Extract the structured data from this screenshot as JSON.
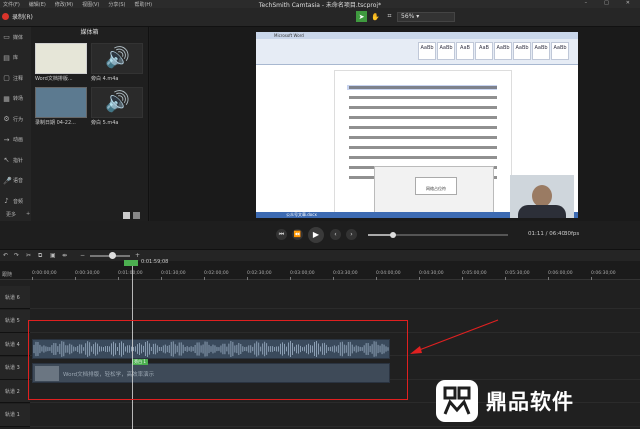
{
  "menu": [
    "文件(F)",
    "编辑(E)",
    "修改(M)",
    "视图(V)",
    "分享(S)",
    "帮助(H)"
  ],
  "window_title": "TechSmith Camtasia - 未命名项目.tscproj*",
  "record_label": "录制(R)",
  "zoom_value": "56%",
  "sidebar": [
    {
      "label": "媒体",
      "icon": "media-icon"
    },
    {
      "label": "库",
      "icon": "library-icon"
    },
    {
      "label": "注释",
      "icon": "annotation-icon"
    },
    {
      "label": "转场",
      "icon": "transition-icon"
    },
    {
      "label": "行为",
      "icon": "behavior-icon"
    },
    {
      "label": "动画",
      "icon": "animation-icon"
    },
    {
      "label": "指针",
      "icon": "cursor-icon"
    },
    {
      "label": "语音",
      "icon": "voice-icon"
    },
    {
      "label": "音频",
      "icon": "audio-icon"
    }
  ],
  "sidebar_more": "更多",
  "sidebar_add": "+",
  "bin": {
    "title": "媒体箱",
    "items": [
      {
        "label": "Word文档排版...",
        "type": "video"
      },
      {
        "label": "旁白 4.m4a",
        "type": "audio"
      },
      {
        "label": "录制日期 04-22...",
        "type": "video"
      },
      {
        "label": "旁白 5.m4a",
        "type": "audio"
      }
    ]
  },
  "preview": {
    "doc_title_bar": "Microsoft Word",
    "dialog_text": "网络占位符",
    "taskbar_item": "公众号文章.docx"
  },
  "playback": {
    "timecode": "01:11 / 06:40",
    "fps": "30fps",
    "progress": 0.18
  },
  "timeline": {
    "zoom_fraction": 0.55,
    "playhead_label": "0:01:59;08",
    "playhead_badge": "",
    "ticks": [
      "0:00:00;00",
      "0:00:30;00",
      "0:01:00;00",
      "0:01:30;00",
      "0:02:00;00",
      "0:02:30;00",
      "0:03:00;00",
      "0:03:30;00",
      "0:04:00;00",
      "0:04:30;00",
      "0:05:00;00",
      "0:05:30;00",
      "0:06:00;00",
      "0:06:30;00"
    ],
    "tracks": [
      "轨道 6",
      "轨道 5",
      "轨道 4",
      "轨道 3",
      "轨道 2",
      "轨道 1"
    ],
    "video_clip_label": "Word文档排版，轻松学，高效率演示",
    "clip_badge": "旁白 1",
    "mini_label": "跟随"
  },
  "watermark": {
    "text": "鼎品软件"
  }
}
